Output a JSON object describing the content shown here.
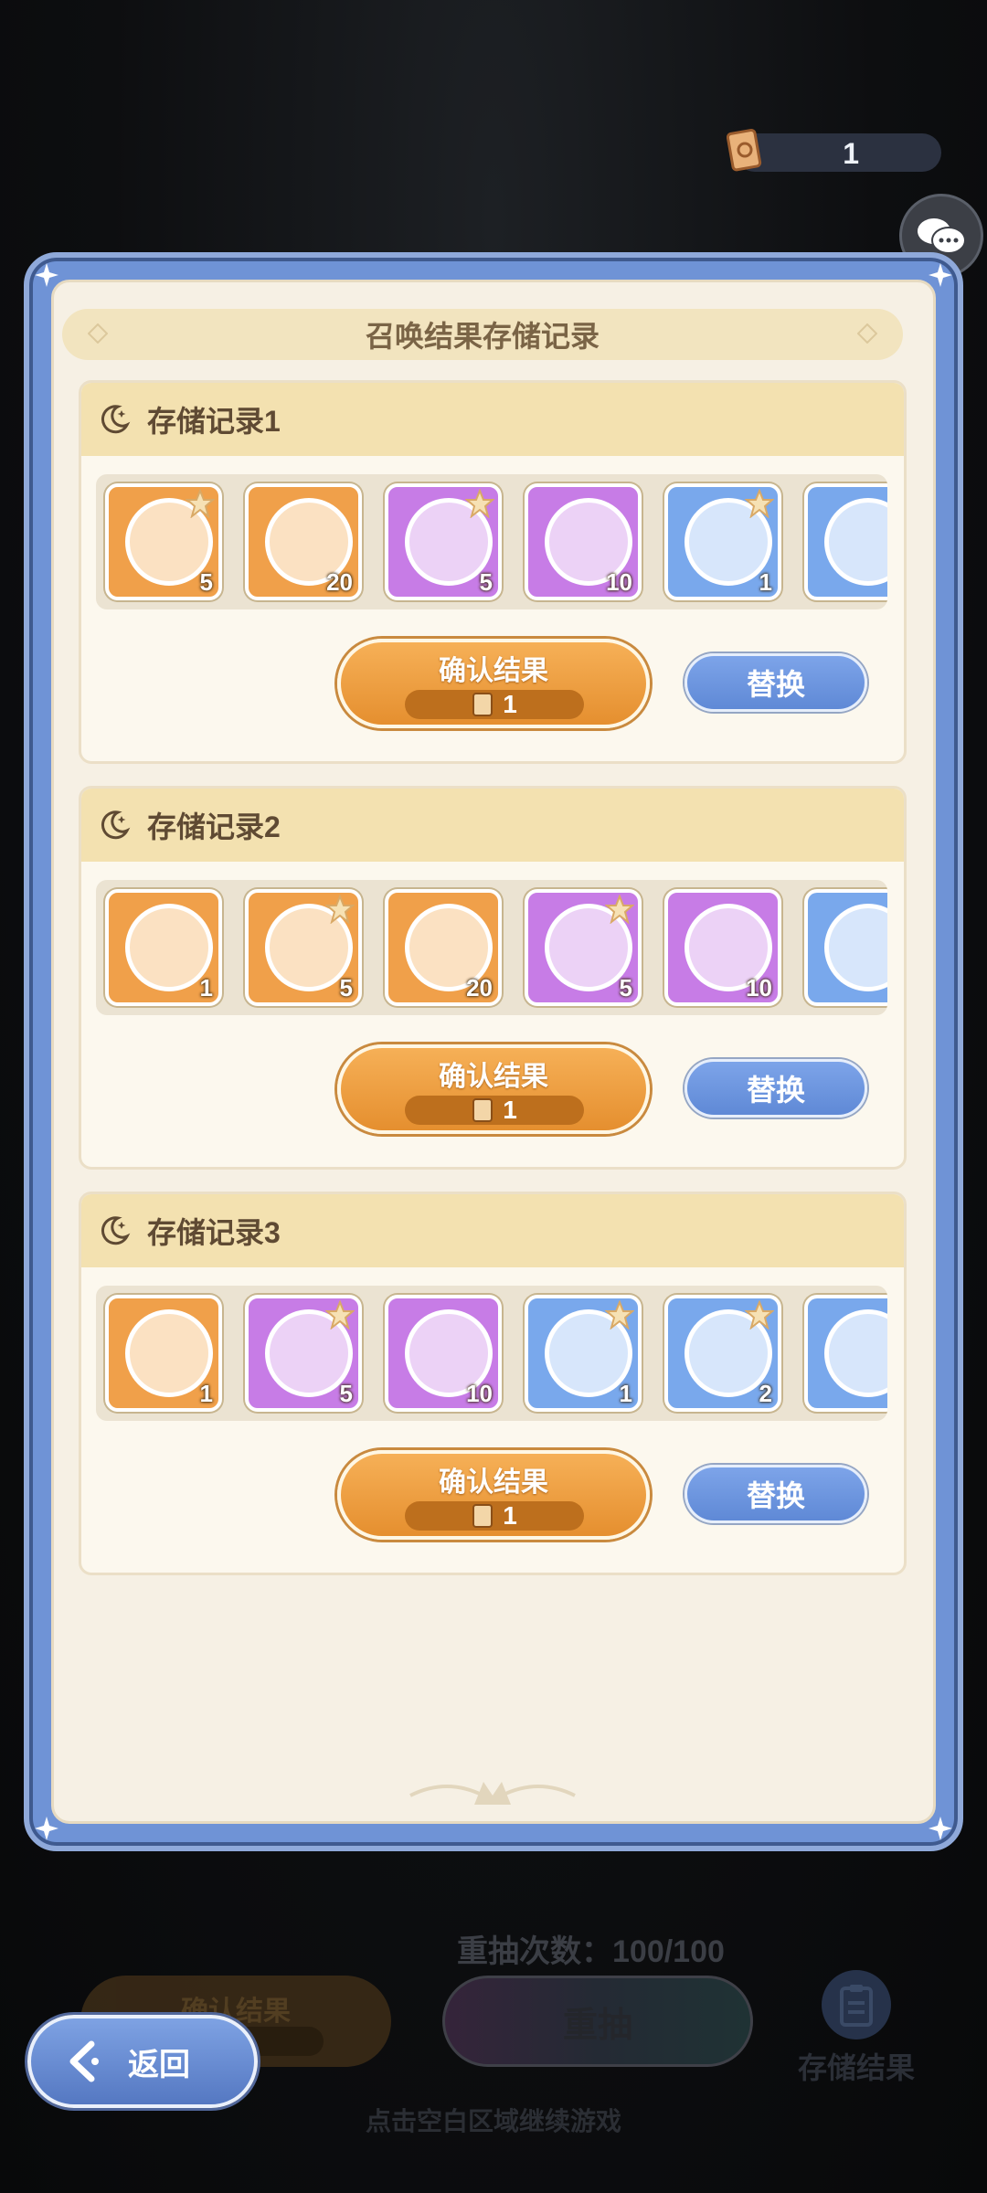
{
  "currency": {
    "icon": "ticket-icon",
    "value": "1"
  },
  "chat": {
    "icon": "chat-bubbles-icon"
  },
  "panel": {
    "title": "召唤结果存储记录"
  },
  "records": [
    {
      "title": "存储记录1",
      "items": [
        {
          "name": "pink-hair-girl",
          "rarity": "orange",
          "count": "5",
          "star": true
        },
        {
          "name": "orange-orb",
          "rarity": "orange",
          "count": "20",
          "star": false
        },
        {
          "name": "pink-dragon",
          "rarity": "purple",
          "count": "5",
          "star": true
        },
        {
          "name": "purple-orb",
          "rarity": "purple",
          "count": "10",
          "star": false
        },
        {
          "name": "green-dragon",
          "rarity": "blue",
          "count": "1",
          "star": true
        },
        {
          "name": "purple-blob",
          "rarity": "blue",
          "count": "",
          "star": false
        }
      ],
      "confirm_label": "确认结果",
      "confirm_cost": "1",
      "replace_label": "替换"
    },
    {
      "title": "存储记录2",
      "items": [
        {
          "name": "black-hat-character",
          "rarity": "orange",
          "count": "1",
          "star": false
        },
        {
          "name": "pink-hair-girl",
          "rarity": "orange",
          "count": "5",
          "star": true
        },
        {
          "name": "orange-orb",
          "rarity": "orange",
          "count": "20",
          "star": false
        },
        {
          "name": "teal-cat",
          "rarity": "purple",
          "count": "5",
          "star": true
        },
        {
          "name": "purple-orb",
          "rarity": "purple",
          "count": "10",
          "star": false
        },
        {
          "name": "white-blob",
          "rarity": "blue",
          "count": "",
          "star": false
        }
      ],
      "confirm_label": "确认结果",
      "confirm_cost": "1",
      "replace_label": "替换"
    },
    {
      "title": "存储记录3",
      "items": [
        {
          "name": "black-hat-character",
          "rarity": "orange",
          "count": "1",
          "star": false
        },
        {
          "name": "teal-cat",
          "rarity": "purple",
          "count": "5",
          "star": true
        },
        {
          "name": "purple-orb",
          "rarity": "purple",
          "count": "10",
          "star": false
        },
        {
          "name": "white-blob",
          "rarity": "blue",
          "count": "1",
          "star": true
        },
        {
          "name": "purple-blob",
          "rarity": "blue",
          "count": "2",
          "star": true
        },
        {
          "name": "grey-cat",
          "rarity": "blue",
          "count": "",
          "star": false
        }
      ],
      "confirm_label": "确认结果",
      "confirm_cost": "1",
      "replace_label": "替换"
    }
  ],
  "bottom": {
    "reroll_count": "重抽次数：100/100",
    "confirm_label": "确认结果",
    "reroll_label": "重抽",
    "store_label": "存储结果",
    "back_label": "返回",
    "hint": "点击空白区域继续游戏"
  },
  "colors": {
    "panel_blue": "#6f93d6",
    "confirm_orange": "#e58f2f",
    "replace_blue": "#5f89d6",
    "rarity_orange": "#f0a04a",
    "rarity_purple": "#c77ce6",
    "rarity_blue": "#79a8ec"
  }
}
